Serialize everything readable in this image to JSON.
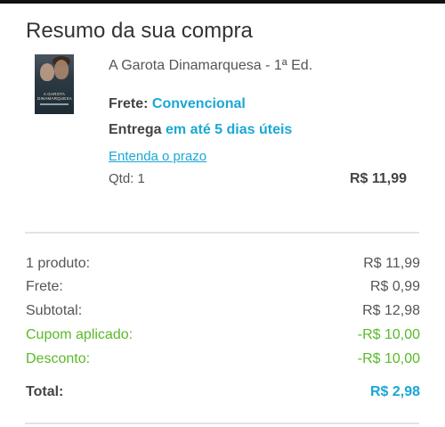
{
  "page": {
    "title": "Resumo da sua compra"
  },
  "product": {
    "name": "A Garota Dinamarquesa - 1ª Ed.",
    "cover_text": "A GAROTA DINAMARQUESA",
    "frete_label": "Frete:",
    "frete_value": "Convencional",
    "entrega_label": "Entrega",
    "entrega_value": "em até 5 dias úteis",
    "prazo_link": "Entenda o prazo",
    "qtd": "Qtd: 1",
    "price": "R$ 11,99"
  },
  "summary": {
    "rows": [
      {
        "label": "1 produto:",
        "value": "R$ 11,99"
      },
      {
        "label": "Frete:",
        "value": "R$ 0,99"
      },
      {
        "label": "Subtotal:",
        "value": "R$ 12,98"
      },
      {
        "label": "Cupom aplicado:",
        "value": "-R$ 10,00"
      },
      {
        "label": "Desconto:",
        "value": "-R$ 10,00"
      }
    ],
    "total_label": "Total:",
    "total_value": "R$ 2,98"
  },
  "colors": {
    "accent": "#1aa7d6",
    "discount": "#5ab92a"
  }
}
